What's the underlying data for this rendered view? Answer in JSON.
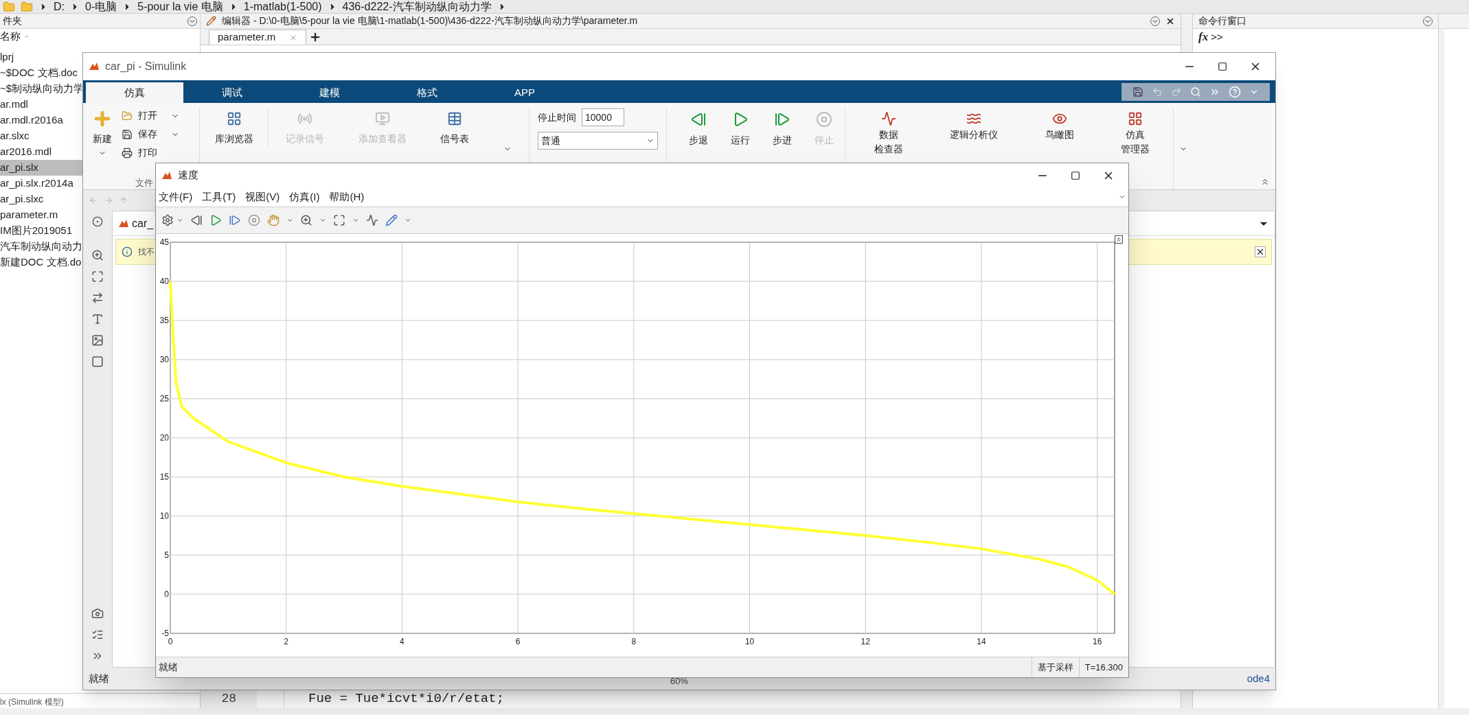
{
  "address_bar": {
    "path": [
      "D:",
      "0-电脑",
      "5-pour la vie 电脑",
      "1-matlab(1-500)",
      "436-d222-汽车制动纵向动力学"
    ]
  },
  "file_browser": {
    "title": "件夹",
    "column": "名称",
    "files": [
      {
        "name": "lprj",
        "selected": false
      },
      {
        "name": "~$DOC 文档.doc",
        "selected": false
      },
      {
        "name": "~$制动纵向动力学",
        "selected": false
      },
      {
        "name": "ar.mdl",
        "selected": false
      },
      {
        "name": "ar.mdl.r2016a",
        "selected": false
      },
      {
        "name": "ar.slxc",
        "selected": false
      },
      {
        "name": "ar2016.mdl",
        "selected": false
      },
      {
        "name": "ar_pi.slx",
        "selected": true
      },
      {
        "name": "ar_pi.slx.r2014a",
        "selected": false
      },
      {
        "name": "ar_pi.slxc",
        "selected": false
      },
      {
        "name": "parameter.m",
        "selected": false
      },
      {
        "name": "IM图片2019051",
        "selected": false
      },
      {
        "name": "汽车制动纵向动力",
        "selected": false
      },
      {
        "name": "新建DOC 文档.do",
        "selected": false
      }
    ],
    "details": "lx (Simulink 模型)"
  },
  "editor": {
    "title": "编辑器 - D:\\0-电脑\\5-pour la vie 电脑\\1-matlab(1-500)\\436-d222-汽车制动纵向动力学\\parameter.m",
    "tabs": [
      {
        "label": "parameter.m",
        "selected": true
      }
    ],
    "lines": [
      {
        "number": "28",
        "code": "Fue = Tue*icvt*i0/r/etat;"
      }
    ]
  },
  "command_window": {
    "title": "命令行窗口",
    "fx": "fx",
    "prompt": ">>"
  },
  "simulink": {
    "title": "car_pi - Simulink",
    "tabs": [
      {
        "label": "仿真",
        "selected": true
      },
      {
        "label": "调试",
        "selected": false
      },
      {
        "label": "建模",
        "selected": false
      },
      {
        "label": "格式",
        "selected": false
      },
      {
        "label": "APP",
        "selected": false
      }
    ],
    "file_group": {
      "new": "新建",
      "open": "打开",
      "save": "保存",
      "print": "打印",
      "label": "文件"
    },
    "library": "库浏览器",
    "signal_buttons": [
      {
        "label": "记录信号",
        "disabled": true,
        "kind": "log"
      },
      {
        "label": "添加查看器",
        "disabled": true,
        "kind": "viewer"
      },
      {
        "label": "信号表",
        "disabled": false,
        "kind": "table"
      }
    ],
    "stop_time": {
      "label": "停止时间",
      "value": "10000"
    },
    "mode": "普通",
    "sim_buttons": [
      {
        "label": "步退",
        "disabled": false,
        "kind": "back"
      },
      {
        "label": "运行",
        "disabled": false,
        "kind": "run"
      },
      {
        "label": "步进",
        "disabled": false,
        "kind": "forward"
      },
      {
        "label": "停止",
        "disabled": true,
        "kind": "stop"
      }
    ],
    "review_buttons": [
      {
        "lines": [
          "数据",
          "检查器"
        ],
        "kind": "inspector"
      },
      {
        "lines": [
          "逻辑分析仪"
        ],
        "kind": "logic"
      },
      {
        "lines": [
          "鸟瞰图"
        ],
        "kind": "birdseye"
      },
      {
        "lines": [
          "仿真",
          "管理器"
        ],
        "kind": "manager"
      }
    ],
    "model_tab": "car_",
    "info": "找不",
    "status": "就绪",
    "zoom": "60%",
    "solver": "ode4"
  },
  "scope": {
    "title": "速度",
    "menus": [
      "文件(F)",
      "工具(T)",
      "视图(V)",
      "仿真(I)",
      "帮助(H)"
    ],
    "chart_data": {
      "type": "line",
      "grid": true,
      "xlim": [
        0,
        16.3
      ],
      "ylim": [
        -5,
        45
      ],
      "xticks": [
        0,
        2,
        4,
        6,
        8,
        10,
        12,
        14,
        16
      ],
      "yticks": [
        -5,
        0,
        5,
        10,
        15,
        20,
        25,
        30,
        35,
        40,
        45
      ],
      "x": [
        0,
        0.05,
        0.1,
        0.2,
        0.4,
        0.8,
        1,
        2,
        3,
        4,
        5,
        6,
        7,
        8,
        9,
        10,
        11,
        12,
        13,
        14,
        15,
        15.5,
        16,
        16.3
      ],
      "series": [
        {
          "color": "#ffff33",
          "values": [
            40,
            33,
            27,
            24,
            22.5,
            20.5,
            19.5,
            16.8,
            15,
            13.8,
            12.8,
            11.8,
            11,
            10.3,
            9.6,
            8.9,
            8.2,
            7.5,
            6.7,
            5.8,
            4.5,
            3.5,
            1.8,
            0
          ]
        }
      ]
    },
    "status": "就绪",
    "sample_mode": "基于采样",
    "time": "T=16.300"
  }
}
